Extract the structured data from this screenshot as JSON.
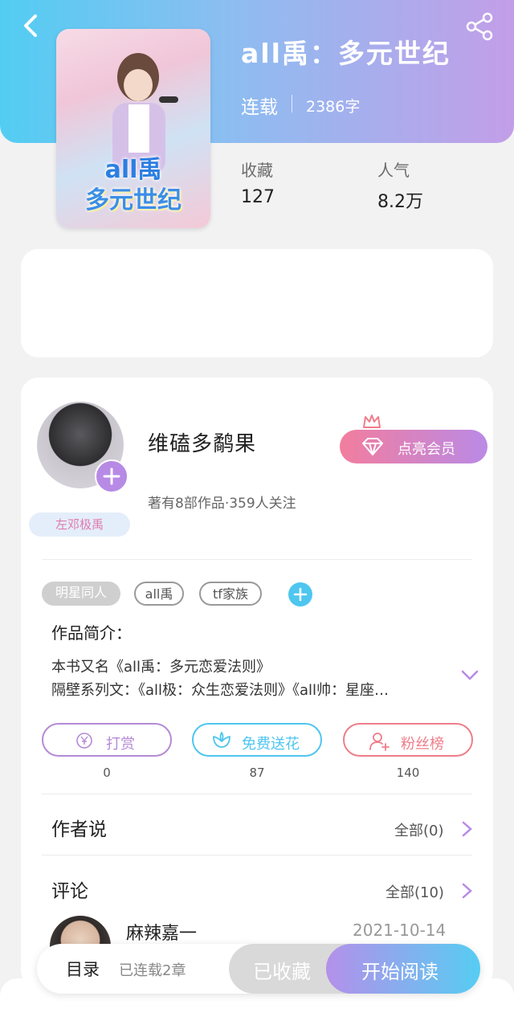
{
  "book": {
    "title": "all禹：多元世纪",
    "status": "连载",
    "word_count": "2386字",
    "cover": {
      "title_line1": "all禹",
      "title_line2": "多元世纪"
    },
    "stats": [
      {
        "label": "收藏",
        "value": "127"
      },
      {
        "label": "人气",
        "value": "8.2万"
      }
    ]
  },
  "author": {
    "name": "维磕多鹬果",
    "meta": "著有8部作品·359人关注",
    "badge": "左邓极禹",
    "vip_label": "点亮会员"
  },
  "tags": [
    "明星同人",
    "all禹",
    "tf家族"
  ],
  "intro": {
    "heading": "作品简介：",
    "line1": "本书又名《all禹：多元恋爱法则》",
    "line2": "隔壁系列文：《all极：众生恋爱法则》《all帅：星座…"
  },
  "actions": [
    {
      "label": "打赏",
      "count": "0",
      "color": "#b58ad6"
    },
    {
      "label": "免费送花",
      "count": "87",
      "color": "#4ec6ef"
    },
    {
      "label": "粉丝榜",
      "count": "140",
      "color": "#ef7d8a"
    }
  ],
  "author_says": {
    "title": "作者说",
    "link": "全部(0)"
  },
  "comments": {
    "title": "评论",
    "link": "全部(10)",
    "first": {
      "name": "麻辣嘉一",
      "date": "2021-10-14"
    }
  },
  "bottom": {
    "toc": "目录",
    "toc_sub": "已连载2章",
    "favorited": "已收藏",
    "read": "开始阅读"
  },
  "colors": {
    "header_start": "#52cdf2",
    "header_end": "#c39ee8",
    "accent_purple": "#b78ae6",
    "accent_blue": "#4ec6ef"
  }
}
